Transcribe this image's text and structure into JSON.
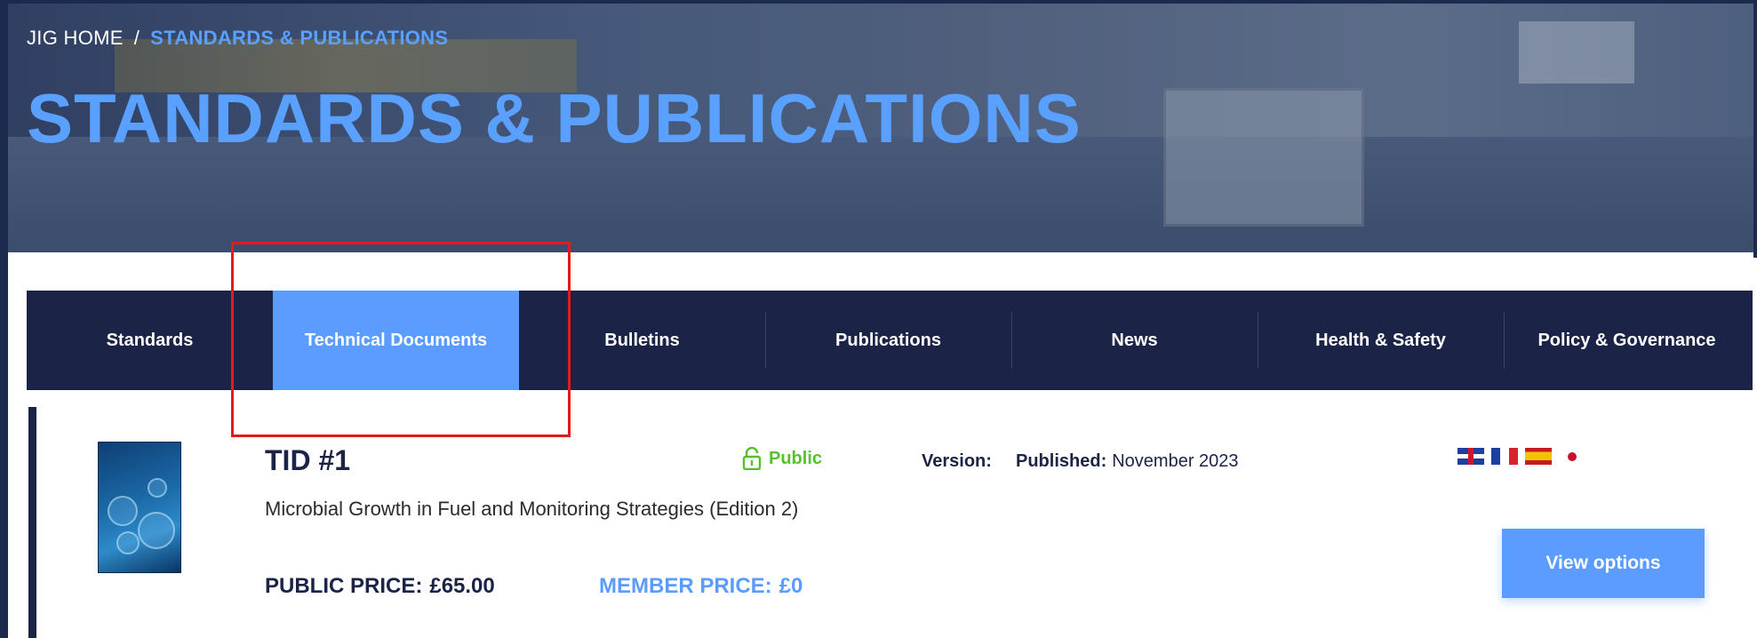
{
  "breadcrumb": {
    "home": "JIG HOME",
    "separator": "/",
    "current": "STANDARDS & PUBLICATIONS"
  },
  "page_title": "STANDARDS & PUBLICATIONS",
  "tabs": [
    {
      "label": "Standards",
      "active": false
    },
    {
      "label": "Technical Documents",
      "active": true
    },
    {
      "label": "Bulletins",
      "active": false
    },
    {
      "label": "Publications",
      "active": false
    },
    {
      "label": "News",
      "active": false
    },
    {
      "label": "Health & Safety",
      "active": false
    },
    {
      "label": "Policy & Governance",
      "active": false
    }
  ],
  "item": {
    "code": "TID #1",
    "access_label": "Public",
    "access_icon": "unlocked-lock-icon",
    "version_label": "Version:",
    "published_label": "Published:",
    "published_value": "November 2023",
    "title": "Microbial Growth in Fuel and Monitoring Strategies (Edition 2)",
    "public_price_label": "PUBLIC PRICE:",
    "public_price_value": "£65.00",
    "member_price_label": "MEMBER PRICE:",
    "member_price_value": "£0",
    "view_options_label": "View options",
    "languages": [
      "uk-flag-icon",
      "france-flag-icon",
      "spain-flag-icon",
      "japan-flag-icon"
    ]
  },
  "colors": {
    "navy": "#1b2346",
    "accent_blue": "#5a9cff",
    "public_green": "#56c12c",
    "highlight_red": "#e11c1c"
  }
}
